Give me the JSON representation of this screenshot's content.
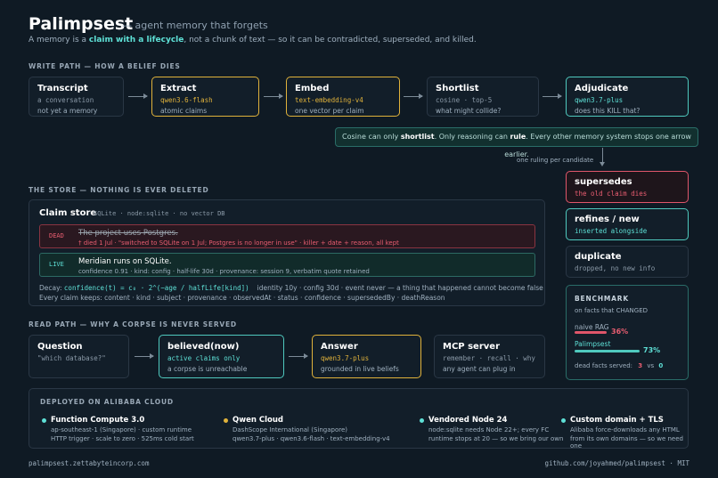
{
  "header": {
    "title": "Palimpsest",
    "tagline": "— agent memory that forgets",
    "subtitle_pre": "A memory is a ",
    "subtitle_bold": "claim with a lifecycle",
    "subtitle_post": ", not a chunk of text — so it can be contradicted, superseded, and killed."
  },
  "write_path": {
    "section": "WRITE PATH — HOW A BELIEF DIES",
    "steps": [
      {
        "title": "Transcript",
        "code": "a conversation",
        "desc": "not yet a memory"
      },
      {
        "title": "Extract",
        "code": "qwen3.6-flash",
        "desc": "atomic claims"
      },
      {
        "title": "Embed",
        "code": "text-embedding-v4",
        "desc": "one vector per claim"
      },
      {
        "title": "Shortlist",
        "code": "cosine · top-5",
        "desc": "what might collide?"
      },
      {
        "title": "Adjudicate",
        "code": "qwen3.7-plus",
        "desc": "does this KILL that?"
      }
    ],
    "callout_pre": "Cosine can only ",
    "callout_b1": "shortlist",
    "callout_mid": ". Only reasoning can ",
    "callout_b2": "rule",
    "callout_post": ". Every other memory system stops one arrow earlier.",
    "ruling_label": "one ruling per candidate"
  },
  "rulings": [
    {
      "title": "supersedes",
      "desc": "the old claim dies"
    },
    {
      "title": "refines / new",
      "desc": "inserted alongside"
    },
    {
      "title": "duplicate",
      "desc": "dropped, no new info"
    }
  ],
  "store": {
    "section": "THE STORE — NOTHING IS EVER DELETED",
    "title": "Claim store",
    "meta": "SQLite · node:sqlite · no vector DB",
    "dead_tag": "DEAD",
    "dead_claim": "The project uses Postgres.",
    "dead_detail": "† died 1 Jul · \"switched to SQLite on 1 Jul; Postgres is no longer in use\" · killer + date + reason, all kept",
    "live_tag": "LIVE",
    "live_claim": "Meridian runs on SQLite.",
    "live_detail": "confidence 0.91 · kind: config · half-life 30d · provenance: session 9, verbatim quote retained",
    "decay_label": "Decay: ",
    "decay_formula": "confidence(t) = c₀ · 2^(−age / halfLife[kind])",
    "decay_rest": "identity 10y · config 30d · event never — a thing that happened cannot become false",
    "fields": "Every claim keeps: content · kind · subject · provenance · observedAt · status · confidence · supersededBy · deathReason"
  },
  "read_path": {
    "section": "READ PATH — WHY A CORPSE IS NEVER SERVED",
    "steps": [
      {
        "title": "Question",
        "code": "\"which database?\"",
        "desc": ""
      },
      {
        "title": "believed(now)",
        "code": "active claims only",
        "desc": "a corpse is unreachable"
      },
      {
        "title": "Answer",
        "code": "qwen3.7-plus",
        "desc": "grounded in live beliefs"
      },
      {
        "title": "MCP server",
        "code": "remember · recall · why",
        "desc": "any agent can plug in"
      }
    ]
  },
  "benchmark": {
    "title": "BENCHMARK",
    "subtitle": "on facts that CHANGED",
    "rows": [
      {
        "label": "naive RAG",
        "value": "36%",
        "fraction": 0.36,
        "color": "#e0566a"
      },
      {
        "label": "Palimpsest",
        "value": "73%",
        "fraction": 0.73,
        "color": "#4fc9be"
      }
    ],
    "dead_served_label": "dead facts served:",
    "dead_a": "3",
    "vs": "vs",
    "dead_b": "0"
  },
  "deploy": {
    "section": "DEPLOYED ON ALIBABA CLOUD",
    "items": [
      {
        "title": "Function Compute 3.0",
        "line1": "ap-southeast-1 (Singapore) · custom runtime",
        "line2": "HTTP trigger · scale to zero · 525ms cold start",
        "color": "#5ee0d6"
      },
      {
        "title": "Qwen Cloud",
        "line1": "DashScope International (Singapore)",
        "line2": "qwen3.7-plus · qwen3.6-flash · text-embedding-v4",
        "color": "#e0b23b"
      },
      {
        "title": "Vendored Node 24",
        "line1": "node:sqlite needs Node 22+; every FC",
        "line2": "runtime stops at 20 — so we bring our own",
        "color": "#5ee0d6"
      },
      {
        "title": "Custom domain + TLS",
        "line1": "Alibaba force-downloads any HTML",
        "line2": "from its own domains — so we need one",
        "color": "#5ee0d6"
      }
    ]
  },
  "footer": {
    "left": "palimpsest.zettabyteincorp.com",
    "right": "github.com/joyahmed/palimpsest · MIT"
  },
  "colors": {
    "teal": "#5ee0d6",
    "yellow": "#e0b23b",
    "red": "#e0566a",
    "background": "#0f1a24"
  }
}
